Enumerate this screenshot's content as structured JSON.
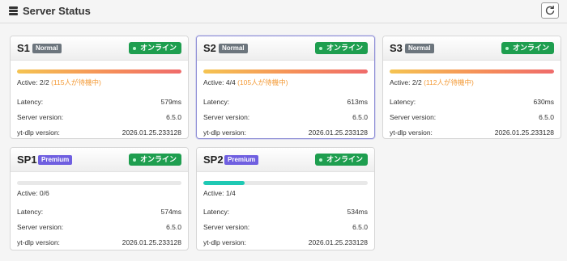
{
  "header": {
    "title": "Server Status",
    "icon": "server-stack-icon",
    "refresh_icon": "refresh-icon"
  },
  "labels": {
    "latency": "Latency:",
    "server_version": "Server version:",
    "ytdlp_version": "yt-dlp version:"
  },
  "colors": {
    "online": "#1e9e4f",
    "normal_badge": "#6c757d",
    "premium_badge": "#6f5fe0",
    "waiting_text": "#f39a36",
    "bar_teal": "#1fc9b4"
  },
  "servers": [
    {
      "name": "S1",
      "tier": "Normal",
      "status": "オンライン",
      "active": "Active: 2/2",
      "waiting": "(115人が待機中)",
      "load": 1.0,
      "latency": "579ms",
      "server_version": "6.5.0",
      "ytdlp_version": "2026.01.25.233128"
    },
    {
      "name": "S2",
      "tier": "Normal",
      "status": "オンライン",
      "active": "Active: 4/4",
      "waiting": "(105人が待機中)",
      "load": 1.0,
      "latency": "613ms",
      "server_version": "6.5.0",
      "ytdlp_version": "2026.01.25.233128"
    },
    {
      "name": "S3",
      "tier": "Normal",
      "status": "オンライン",
      "active": "Active: 2/2",
      "waiting": "(112人が待機中)",
      "load": 1.0,
      "latency": "630ms",
      "server_version": "6.5.0",
      "ytdlp_version": "2026.01.25.233128"
    },
    {
      "name": "SP1",
      "tier": "Premium",
      "status": "オンライン",
      "active": "Active: 0/6",
      "waiting": "",
      "load": 0.0,
      "latency": "574ms",
      "server_version": "6.5.0",
      "ytdlp_version": "2026.01.25.233128"
    },
    {
      "name": "SP2",
      "tier": "Premium",
      "status": "オンライン",
      "active": "Active: 1/4",
      "waiting": "",
      "load": 0.25,
      "latency": "534ms",
      "server_version": "6.5.0",
      "ytdlp_version": "2026.01.25.233128"
    }
  ]
}
